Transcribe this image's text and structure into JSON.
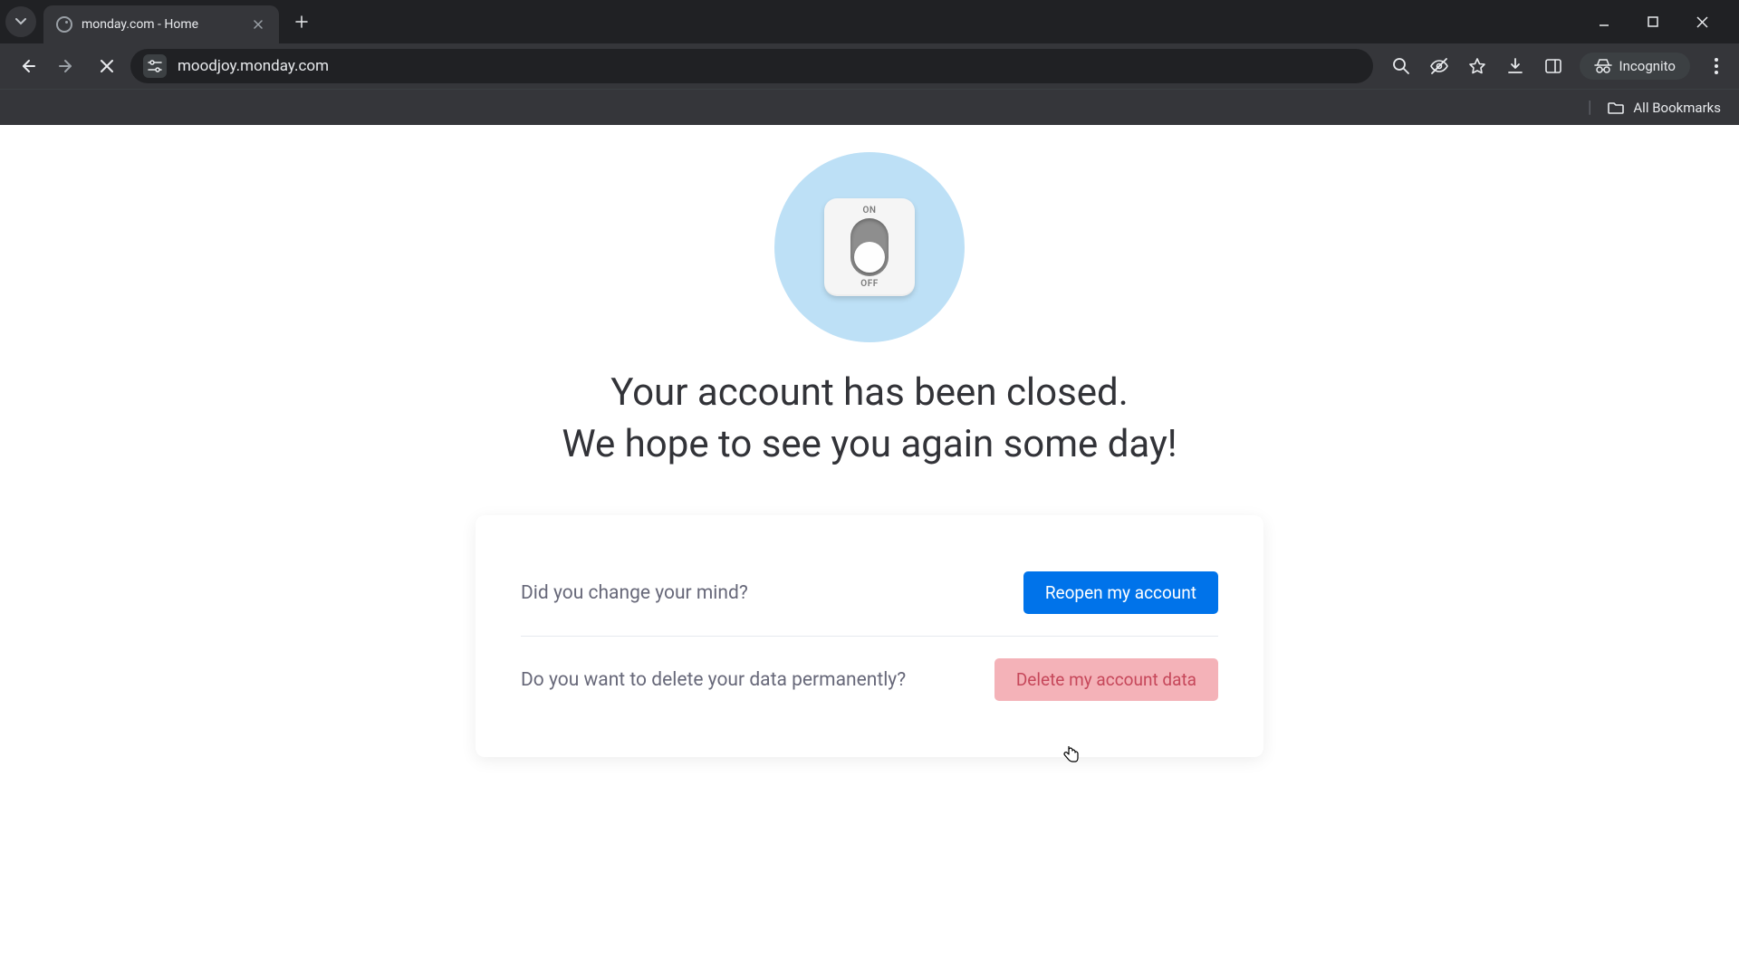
{
  "browser": {
    "tab_title": "monday.com - Home",
    "url": "moodjoy.monday.com",
    "incognito_label": "Incognito",
    "all_bookmarks_label": "All Bookmarks"
  },
  "switch": {
    "on_label": "ON",
    "off_label": "OFF"
  },
  "headline": {
    "line1": "Your account has been closed.",
    "line2": "We hope to see you again some day!"
  },
  "card": {
    "reopen_prompt": "Did you change your mind?",
    "reopen_button": "Reopen my account",
    "delete_prompt": "Do you want to delete your data permanently?",
    "delete_button": "Delete my account data"
  }
}
